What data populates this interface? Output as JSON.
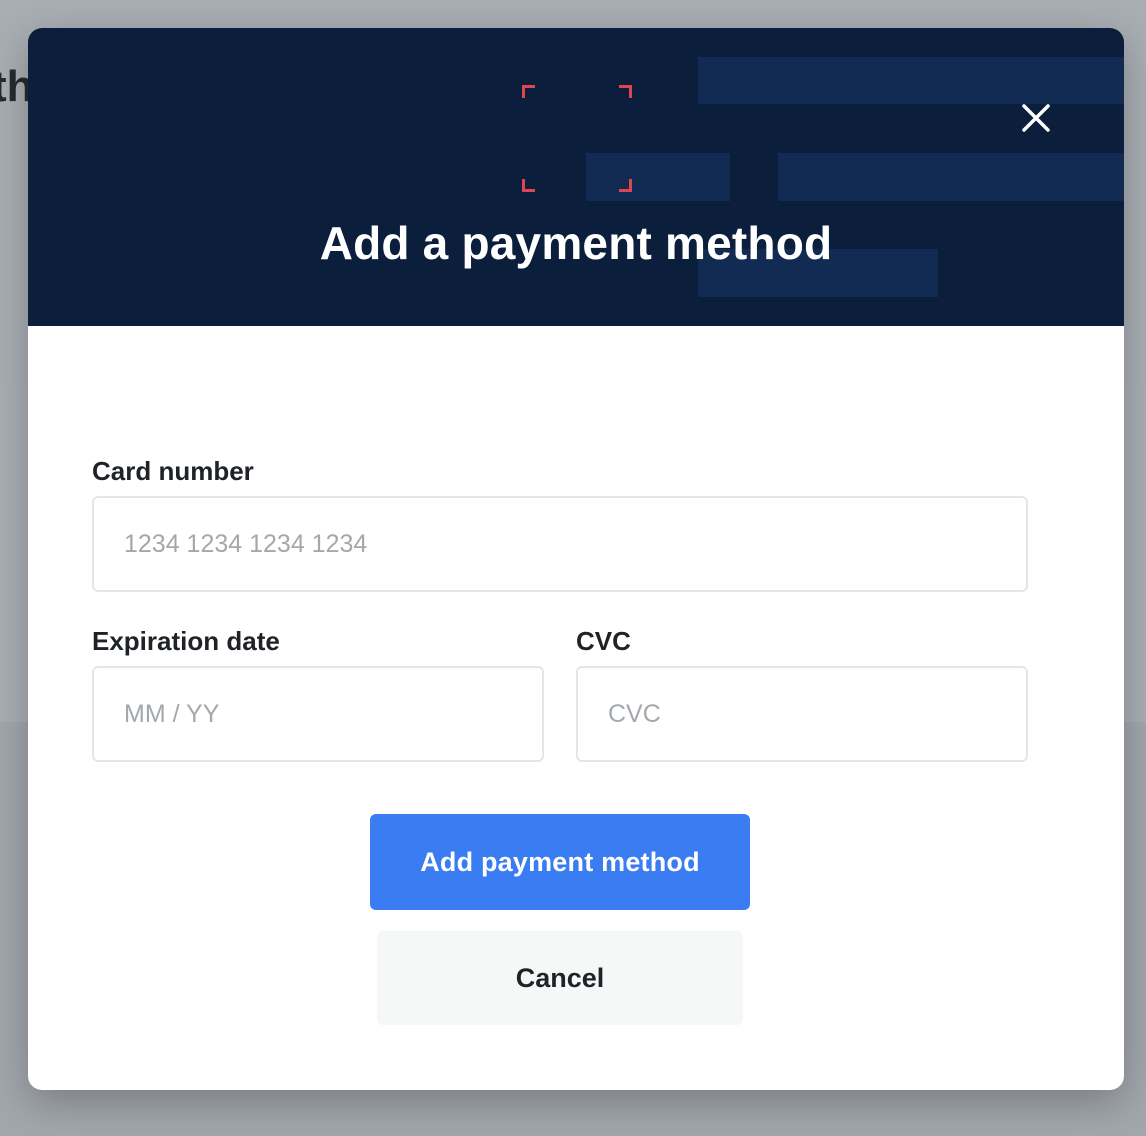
{
  "background": {
    "heading_fragment": "th"
  },
  "modal": {
    "title": "Add a payment method",
    "close_icon": "close-icon",
    "colors": {
      "header_bg": "#0b1e3c",
      "accent_bracket": "#e0454f",
      "primary_button": "#3a7cf2"
    }
  },
  "form": {
    "card_number": {
      "label": "Card number",
      "value": "",
      "placeholder": "1234 1234 1234 1234"
    },
    "expiration": {
      "label": "Expiration date",
      "value": "",
      "placeholder": "MM / YY"
    },
    "cvc": {
      "label": "CVC",
      "value": "",
      "placeholder": "CVC"
    }
  },
  "actions": {
    "submit_label": "Add payment method",
    "cancel_label": "Cancel"
  }
}
